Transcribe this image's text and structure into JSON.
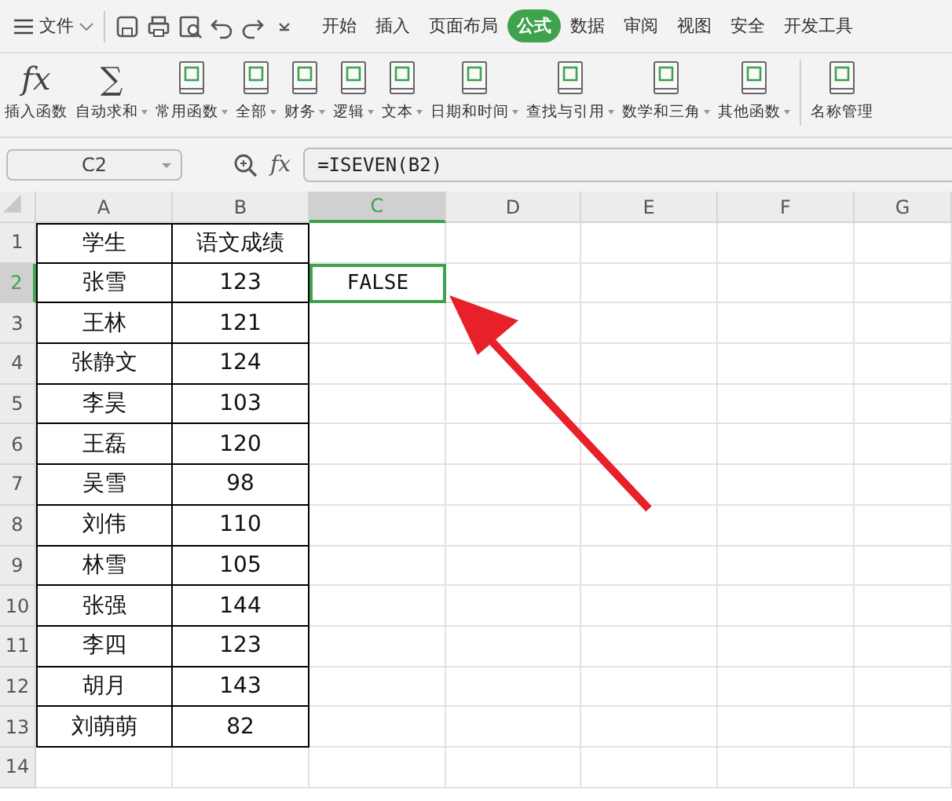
{
  "menu": {
    "file_label": "文件",
    "tabs": [
      {
        "label": "开始",
        "selected": false
      },
      {
        "label": "插入",
        "selected": false
      },
      {
        "label": "页面布局",
        "selected": false
      },
      {
        "label": "公式",
        "selected": true
      },
      {
        "label": "数据",
        "selected": false
      },
      {
        "label": "审阅",
        "selected": false
      },
      {
        "label": "视图",
        "selected": false
      },
      {
        "label": "安全",
        "selected": false
      },
      {
        "label": "开发工具",
        "selected": false
      }
    ]
  },
  "ribbon": [
    {
      "kind": "glyph",
      "glyph": "fx",
      "label": "插入函数",
      "dropdown": false
    },
    {
      "kind": "glyph",
      "glyph": "∑",
      "label": "自动求和",
      "dropdown": true
    },
    {
      "kind": "book",
      "label": "常用函数",
      "dropdown": true
    },
    {
      "kind": "book",
      "label": "全部",
      "dropdown": true
    },
    {
      "kind": "book",
      "label": "财务",
      "dropdown": true
    },
    {
      "kind": "book",
      "label": "逻辑",
      "dropdown": true
    },
    {
      "kind": "book",
      "label": "文本",
      "dropdown": true
    },
    {
      "kind": "book",
      "label": "日期和时间",
      "dropdown": true
    },
    {
      "kind": "book",
      "label": "查找与引用",
      "dropdown": true
    },
    {
      "kind": "book",
      "label": "数学和三角",
      "dropdown": true
    },
    {
      "kind": "book",
      "label": "其他函数",
      "dropdown": true
    },
    {
      "kind": "separator"
    },
    {
      "kind": "book",
      "label": "名称管理",
      "dropdown": false
    }
  ],
  "formula_bar": {
    "name_box": "C2",
    "fx": "fx",
    "formula": "=ISEVEN(B2)"
  },
  "sheet": {
    "columns": [
      {
        "label": "A",
        "selected": false
      },
      {
        "label": "B",
        "selected": false
      },
      {
        "label": "C",
        "selected": true
      },
      {
        "label": "D",
        "selected": false
      },
      {
        "label": "E",
        "selected": false
      },
      {
        "label": "F",
        "selected": false
      },
      {
        "label": "G",
        "selected": false
      }
    ],
    "rows": [
      {
        "number": "1",
        "selected": false,
        "cells": [
          {
            "text": "学生",
            "selected": false
          },
          {
            "text": "语文成绩",
            "selected": false
          },
          {
            "text": "",
            "selected": false
          }
        ]
      },
      {
        "number": "2",
        "selected": true,
        "cells": [
          {
            "text": "张雪",
            "selected": false
          },
          {
            "text": "123",
            "selected": false
          },
          {
            "text": "FALSE",
            "selected": true
          }
        ]
      },
      {
        "number": "3",
        "selected": false,
        "cells": [
          {
            "text": "王林",
            "selected": false
          },
          {
            "text": "121",
            "selected": false
          },
          {
            "text": "",
            "selected": false
          }
        ]
      },
      {
        "number": "4",
        "selected": false,
        "cells": [
          {
            "text": "张静文",
            "selected": false
          },
          {
            "text": "124",
            "selected": false
          },
          {
            "text": "",
            "selected": false
          }
        ]
      },
      {
        "number": "5",
        "selected": false,
        "cells": [
          {
            "text": "李昊",
            "selected": false
          },
          {
            "text": "103",
            "selected": false
          },
          {
            "text": "",
            "selected": false
          }
        ]
      },
      {
        "number": "6",
        "selected": false,
        "cells": [
          {
            "text": "王磊",
            "selected": false
          },
          {
            "text": "120",
            "selected": false
          },
          {
            "text": "",
            "selected": false
          }
        ]
      },
      {
        "number": "7",
        "selected": false,
        "cells": [
          {
            "text": "吴雪",
            "selected": false
          },
          {
            "text": "98",
            "selected": false
          },
          {
            "text": "",
            "selected": false
          }
        ]
      },
      {
        "number": "8",
        "selected": false,
        "cells": [
          {
            "text": "刘伟",
            "selected": false
          },
          {
            "text": "110",
            "selected": false
          },
          {
            "text": "",
            "selected": false
          }
        ]
      },
      {
        "number": "9",
        "selected": false,
        "cells": [
          {
            "text": "林雪",
            "selected": false
          },
          {
            "text": "105",
            "selected": false
          },
          {
            "text": "",
            "selected": false
          }
        ]
      },
      {
        "number": "10",
        "selected": false,
        "cells": [
          {
            "text": "张强",
            "selected": false
          },
          {
            "text": "144",
            "selected": false
          },
          {
            "text": "",
            "selected": false
          }
        ]
      },
      {
        "number": "11",
        "selected": false,
        "cells": [
          {
            "text": "李四",
            "selected": false
          },
          {
            "text": "123",
            "selected": false
          },
          {
            "text": "",
            "selected": false
          }
        ]
      },
      {
        "number": "12",
        "selected": false,
        "cells": [
          {
            "text": "胡月",
            "selected": false
          },
          {
            "text": "143",
            "selected": false
          },
          {
            "text": "",
            "selected": false
          }
        ]
      },
      {
        "number": "13",
        "selected": false,
        "cells": [
          {
            "text": "刘萌萌",
            "selected": false
          },
          {
            "text": "82",
            "selected": false
          },
          {
            "text": "",
            "selected": false
          }
        ]
      },
      {
        "number": "14",
        "selected": false,
        "cells": [
          {
            "text": "",
            "selected": false
          },
          {
            "text": "",
            "selected": false
          },
          {
            "text": "",
            "selected": false
          }
        ]
      }
    ]
  }
}
